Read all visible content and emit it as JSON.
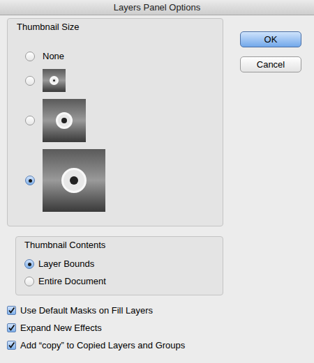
{
  "window": {
    "title": "Layers Panel Options"
  },
  "thumbnail_size": {
    "title": "Thumbnail Size",
    "options": [
      {
        "kind": "none",
        "label": "None",
        "selected": false
      },
      {
        "kind": "small",
        "selected": false
      },
      {
        "kind": "medium",
        "selected": false
      },
      {
        "kind": "large",
        "selected": true
      }
    ]
  },
  "thumbnail_contents": {
    "title": "Thumbnail Contents",
    "options": [
      {
        "label": "Layer Bounds",
        "selected": true
      },
      {
        "label": "Entire Document",
        "selected": false
      }
    ]
  },
  "checkboxes": [
    {
      "label": "Use Default Masks on Fill Layers",
      "checked": true
    },
    {
      "label": "Expand New Effects",
      "checked": true
    },
    {
      "label": "Add “copy” to Copied Layers and Groups",
      "checked": true
    }
  ],
  "buttons": [
    {
      "label": "OK",
      "default": true
    },
    {
      "label": "Cancel",
      "default": false
    }
  ]
}
